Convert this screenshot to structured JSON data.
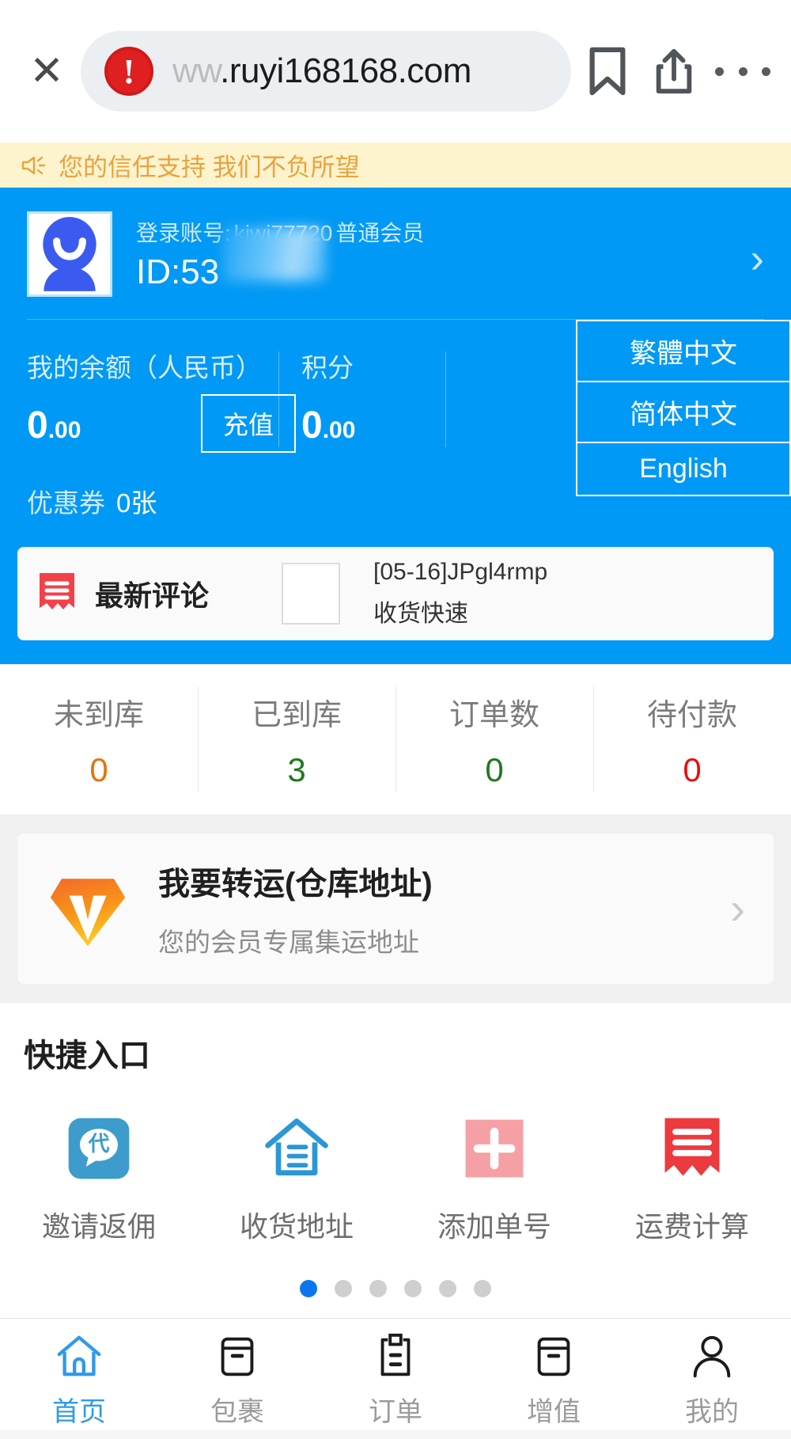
{
  "browser": {
    "close_label": "✕",
    "url_faded": "ww",
    "url_main": ".ruyi168168.com",
    "bookmark_icon": "bookmark-icon",
    "share_icon": "share-icon",
    "menu_icon": "more-menu-icon",
    "warning_icon": "insecure-site-icon"
  },
  "notice": {
    "icon": "speaker-icon",
    "text": "您的信任支持 我们不负所望",
    "bg_color": "#fdf3cd",
    "text_color": "#e8a33d"
  },
  "hero": {
    "bg_color": "#0099f5",
    "avatar_icon": "user-avatar",
    "account_label": "登录账号:",
    "account_name": "kiwi77720",
    "member_level": "普通会员",
    "id_label": "ID:53",
    "chevron": "›",
    "wallet": {
      "balance_label": "我的余额（人民币）",
      "balance_int": "0",
      "balance_dec": ".00",
      "recharge_label": "充值",
      "points_label": "积分",
      "points_int": "0",
      "points_dec": ".00"
    },
    "languages": [
      {
        "label": "繁體中文"
      },
      {
        "label": "简体中文"
      },
      {
        "label": "English"
      }
    ],
    "coupon_label": "优惠券",
    "coupon_count": "0张"
  },
  "comment_card": {
    "icon": "receipt-icon",
    "title": "最新评论",
    "thumb_icon": "comment-thumbnail",
    "entry_title": "[05-16]JPgl4rmp",
    "entry_text": "收货快速"
  },
  "stats": [
    {
      "label": "未到库",
      "value": "0",
      "color": "#e8730a"
    },
    {
      "label": "已到库",
      "value": "3",
      "color": "#1e7a1e"
    },
    {
      "label": "订单数",
      "value": "0",
      "color": "#1e7a1e"
    },
    {
      "label": "待付款",
      "value": "0",
      "color": "#e81010"
    }
  ],
  "transfer": {
    "icon": "v-diamond-logo",
    "title": "我要转运(仓库地址)",
    "subtitle": "您的会员专属集运地址",
    "chevron": "›"
  },
  "quick": {
    "title": "快捷入口",
    "items": [
      {
        "label": "邀请返佣",
        "icon": "invite-rebate-icon",
        "color": "#3d9ccc"
      },
      {
        "label": "收货地址",
        "icon": "delivery-address-icon",
        "color": "#2c96d6"
      },
      {
        "label": "添加单号",
        "icon": "add-tracking-number-icon",
        "color": "#f5a0a4"
      },
      {
        "label": "运费计算",
        "icon": "shipping-calculator-icon",
        "color": "#ec3a3f"
      }
    ],
    "dots": {
      "count": 6,
      "active_index": 0,
      "active_color": "#0a77ef"
    }
  },
  "bottom_nav": [
    {
      "label": "首页",
      "icon": "home-icon",
      "active": true
    },
    {
      "label": "包裹",
      "icon": "package-icon",
      "active": false
    },
    {
      "label": "订单",
      "icon": "order-clipboard-icon",
      "active": false
    },
    {
      "label": "增值",
      "icon": "value-added-box-icon",
      "active": false
    },
    {
      "label": "我的",
      "icon": "profile-person-icon",
      "active": false
    }
  ]
}
